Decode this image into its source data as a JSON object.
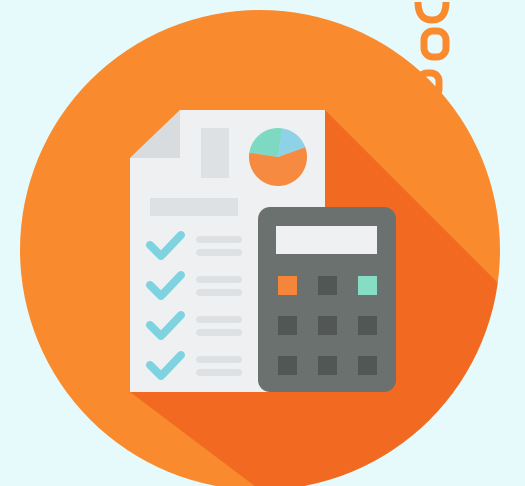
{
  "illustration": {
    "subject": "accounting-calculator-checklist",
    "colors": {
      "background": "#e6fafb",
      "circle": "#f98a2d",
      "shadow": "#f26a22",
      "paper": "#eef0f1",
      "paper_fold": "#d9dcde",
      "paper_lines": "#dee1e3",
      "check": "#7fd3e0",
      "pie_orange": "#f68a40",
      "pie_green": "#7ed9c3",
      "pie_blue": "#8dd2e6",
      "calculator_body": "#6b716f",
      "calculator_screen": "#eef0f1",
      "key_dark": "#525654",
      "key_orange": "#f6853c",
      "key_green": "#86ddc4"
    },
    "checklist": {
      "items": [
        {
          "checked": true
        },
        {
          "checked": true
        },
        {
          "checked": true
        },
        {
          "checked": true
        }
      ]
    },
    "pie_chart": {
      "slices": [
        {
          "color": "pie_orange",
          "value": 0.58
        },
        {
          "color": "pie_green",
          "value": 0.25
        },
        {
          "color": "pie_blue",
          "value": 0.17
        }
      ]
    },
    "calculator": {
      "keys": [
        {
          "row": 1,
          "col": 1,
          "color": "key_orange"
        },
        {
          "row": 1,
          "col": 2,
          "color": "key_dark"
        },
        {
          "row": 1,
          "col": 3,
          "color": "key_green"
        },
        {
          "row": 2,
          "col": 1,
          "color": "key_dark"
        },
        {
          "row": 2,
          "col": 2,
          "color": "key_dark"
        },
        {
          "row": 2,
          "col": 3,
          "color": "key_dark"
        },
        {
          "row": 3,
          "col": 1,
          "color": "key_dark"
        },
        {
          "row": 3,
          "col": 2,
          "color": "key_dark"
        },
        {
          "row": 3,
          "col": 3,
          "color": "key_dark"
        }
      ]
    }
  }
}
